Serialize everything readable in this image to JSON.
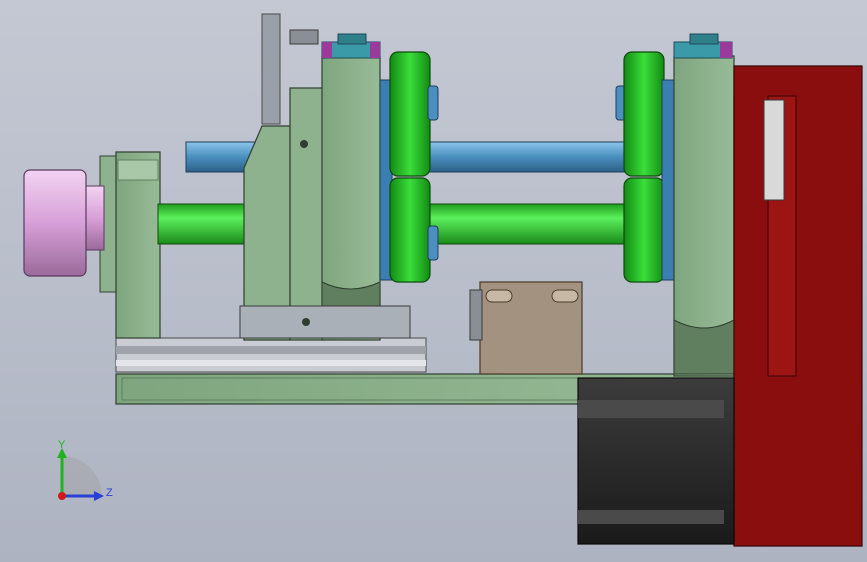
{
  "viewport": {
    "background_top": "#c4c8d3",
    "background_bottom": "#aeb3c1"
  },
  "colors": {
    "frame_green": "#8fb28e",
    "frame_green_dark": "#5f7f5f",
    "shaft_green": "#2ecc2e",
    "roller_green": "#24c024",
    "shaft_blue": "#4a8fbf",
    "cap_teal": "#3a9aa8",
    "cap_purple": "#9a3a9a",
    "motor_black": "#2a2a2a",
    "plate_red": "#8b0e0e",
    "pulley_pink": "#d8a0d8",
    "bracket_tan": "#a39280"
  },
  "triad": {
    "y_label": "Y",
    "z_label": "Z",
    "y_color": "#1fb31f",
    "z_color": "#2a3fd6",
    "x_color": "#d11a1a"
  }
}
